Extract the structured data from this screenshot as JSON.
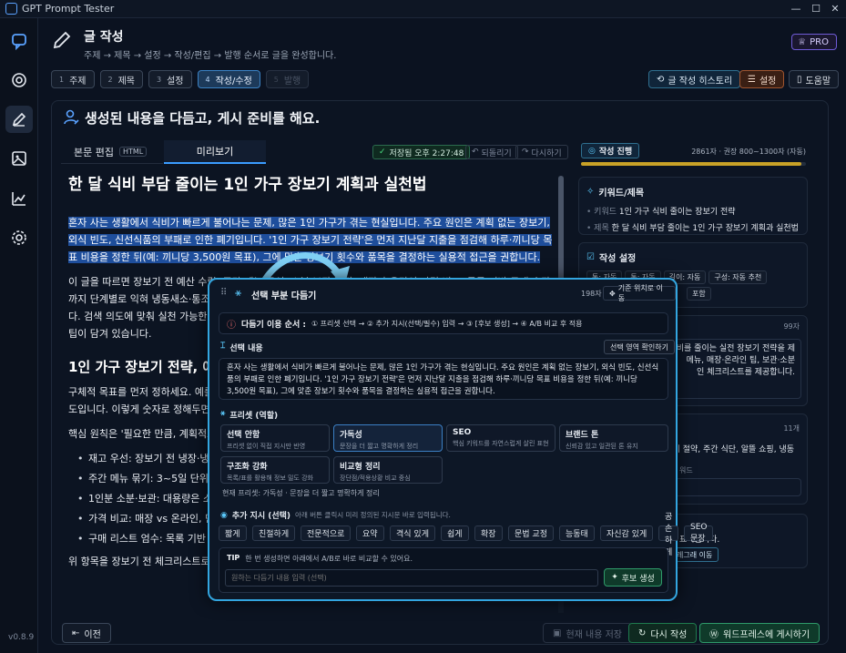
{
  "app": {
    "title": "GPT Prompt Tester",
    "version": "v0.8.9"
  },
  "header": {
    "title": "글 작성",
    "subtitle": "주제 → 제목 → 설정 → 작성/편집 → 발행 순서로 글을 완성합니다.",
    "pro_label": "PRO"
  },
  "steps": [
    {
      "num": "1",
      "label": "주제"
    },
    {
      "num": "2",
      "label": "제목"
    },
    {
      "num": "3",
      "label": "설정"
    },
    {
      "num": "4",
      "label": "작성/수정"
    },
    {
      "num": "5",
      "label": "발행"
    }
  ],
  "toolbar": {
    "history": "글 작성 히스토리",
    "settings": "설정",
    "help": "도움말"
  },
  "section": {
    "title": "생성된 내용을 다듬고, 게시 준비를 해요."
  },
  "editor": {
    "tab_edit": "본문 편집",
    "tab_edit_tag": "HTML",
    "tab_preview": "미리보기",
    "saved": "저장됨 오후 2:27:48",
    "undo": "되돌리기",
    "redo": "다시하기",
    "doc_title": "한 달 식비 부담 줄이는 1인 가구 장보기 계획과 실천법",
    "para1": "혼자 사는 생활에서 식비가 빠르게 불어나는 문제, 많은 1인 가구가 겪는 현실입니다. 주요 원인은 계획 없는 장보기, 외식 빈도, 신선식품의 부패로 인한 폐기입니다. '1인 가구 장보기 전략'은 먼저 지난달 지출을 점검해 하루·끼니당 목표 비용을 정한 뒤(예: 끼니당 3,500원 목표), 그에 맞춘 장보기 횟수와 품목을 결정하는 실용적 접근을 권합니다.",
    "para2": "이 글을 따르면 장보기 전 예산 수립, 주간 메뉴 구성, 소분·보관 방법, 매장과 온라인 가격 비교, 목록 기반 구매 습관까지 단계별로 익혀 냉동새소·통조림·곡류 같은 필수 식재료를 활용해 식비 부담을 줄이는 방법을 받아가실 수 있습니다. 검색 의도에 맞춰 실천 가능한 체크리스트와 예시 표를 포함했으니 한 번만 점검해보세요. 오늘 바로 적용 가능한 팁이 담겨 있습니다.",
    "h2": "1인 가구 장보기 전략, 예산부터 시작하기",
    "para3": "구체적 목표를 먼저 정하세요. 예를 들어 한 달 식비 30만원이라면 하루 약 1만원, 1식당 허용비용은 약 3,600원 정도입니다. 이렇게 숫자로 정해두면 장보기 때 선택이 쉬워지고 실적이고 지속 가능한 계획이 됩니다.",
    "para4": "핵심 원칙은 '필요한 만큼, 계획적으로' 입니다. 다음 항목을 장보기 전에 점검하세요.",
    "bullets": [
      "재고 우선: 장보기 전 냉장·냉동실 재고 확인",
      "주간 메뉴 묶기: 3~5일 단위로 메뉴 구성",
      "1인분 소분·보관: 대용량은 소분 후 냉동",
      "가격 비교: 매장 vs 온라인, 단위 가격 확인",
      "구매 리스트 엄수: 목록 기반 구매 습관"
    ],
    "para5": "위 항목을 장보기 전 체크리스트로 활용하면 불필요한 지출을 줄일 수 있습니다."
  },
  "right": {
    "progress_title": "작성 진행",
    "progress_info": "2861자 · 권장 800~1300자 (자동)",
    "progress": 0.98,
    "kw_title": "키워드/제목",
    "kw_label": "키워드",
    "kw_value": "1인 가구 식비 줄이는 장보기 전략",
    "title_label": "제목",
    "title_value": "한 달 식비 부담 줄이는 1인 가구 장보기 계획과 실천법",
    "settings_title": "작성 설정",
    "chips": [
      "톤: 자동",
      "톤: 자동",
      "길이: 자동",
      "구성: 자동 추천"
    ],
    "chip_extra": "포함",
    "count1": "99자",
    "desc1": "비를 줄이는 실전 장보기 전략을 제",
    "desc2": "메뉴, 매장·온라인 팁, 보관·소분",
    "desc3": "인 체크리스트를 제공합니다.",
    "count2": "11개",
    "desc4": "비 절약, 주간 식단, 알뜰 쇼핑, 냉동",
    "desc5": "워드",
    "desc6": "표시됩니다.",
    "desc7": "레그래 이동"
  },
  "popup": {
    "title": "선택 부분 다듬기",
    "count": "198자",
    "reset": "기준 위치로 이동",
    "flow_label": "다듬기 이용 순서 :",
    "flow": "① 프리셋 선택 → ② 추가 지시(선택/필수) 입력 → ③ [후보 생성] → ④ A/B 비교 후 적용",
    "sel_label": "선택 내용",
    "sel_btn": "선택 영역 확인하기",
    "sel_text": "혼자 사는 생활에서 식비가 빠르게 불어나는 문제, 많은 1인 가구가 겪는 현실입니다. 주요 원인은 계획 없는 장보기, 외식 빈도, 신선식품의 부패로 인한 폐기입니다. '1인 가구 장보기 전략'은 먼저 지난달 지출을 점검해 하루·끼니당 목표 비용을 정한 뒤(예: 끼니당 3,500원 목표), 그에 맞춘 장보기 횟수와 품목을 결정하는 실용적 접근을 권합니다.",
    "preset_label": "프리셋 (역할)",
    "presets": [
      {
        "name": "선택 안함",
        "desc": "프리셋 없이 직접 지시만 반영"
      },
      {
        "name": "가독성",
        "desc": "문장을 더 짧고 명확하게 정리"
      },
      {
        "name": "SEO",
        "desc": "핵심 키워드를 자연스럽게 살린 표현"
      },
      {
        "name": "브랜드 톤",
        "desc": "신뢰감 있고 일관된 톤 유지"
      },
      {
        "name": "구조화 강화",
        "desc": "목록/표를 활용해 정보 밀도 강화"
      },
      {
        "name": "비교형 정리",
        "desc": "장단점/적용상황 비교 중심"
      }
    ],
    "current_preset": "현재 프리셋: 가독성 · 문장을 더 짧고 명확하게 정리",
    "extra_label": "추가 지시 (선택)",
    "extra_hint": "아래 버튼 클릭시 미리 정의된 지시문 바로 입력됩니다.",
    "instructions": [
      "짧게",
      "친절하게",
      "전문적으로",
      "요약",
      "격식 있게",
      "쉽게",
      "확장",
      "문법 교정",
      "능동태",
      "자신감 있게",
      "공손하게",
      "SEO 문장"
    ],
    "tip_label": "TIP",
    "tip_text": "한 번 생성하면 아래에서 A/B로 바로 비교할 수 있어요.",
    "input_placeholder": "원하는 다듬기 내용 입력 (선택)",
    "generate": "후보 생성"
  },
  "bottom": {
    "prev": "이전",
    "save": "현재 내용 저장",
    "rewrite": "다시 작성",
    "publish": "워드프레스에 게시하기"
  },
  "colors": {
    "accent": "#33a6e0",
    "highlight": "#1e4e9c",
    "progress": "#c9a227",
    "success": "#1f7a4e"
  }
}
